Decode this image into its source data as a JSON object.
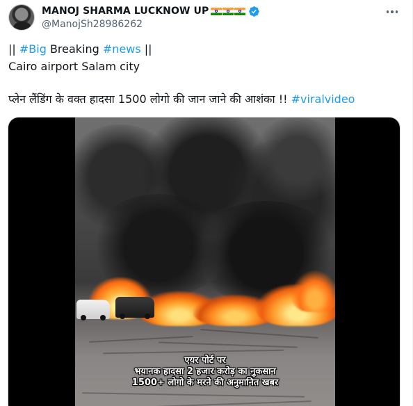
{
  "author": {
    "display_name": "MANOJ SHARMA LUCKNOW UP",
    "handle": "@ManojSh28986262",
    "name_flags": [
      "indian-flag",
      "indian-flag",
      "indian-flag"
    ],
    "verified_badge_color": "#1d9bf0"
  },
  "tweet": {
    "line1": {
      "prefix": "|| ",
      "hashtag1": "#Big",
      "middle": " Breaking ",
      "hashtag2": "#news",
      "suffix": " ||"
    },
    "line2": "Cairo airport Salam city",
    "line3": {
      "text": "प्लेन लैंडिंग के वक्त हादसा 1500 लोगो की जान जाने की आशंका !! ",
      "hashtag": "#viralvideo"
    }
  },
  "media": {
    "caption_lines": [
      "एयर पोर्ट पर",
      "भयानक हादसा 2 हजार करोड़ का नुकसान",
      "1500+ लोगो के मरने की अनुमानित खबर"
    ]
  },
  "colors": {
    "link": "#1d9bf0",
    "text_primary": "#0f1419",
    "text_secondary": "#536471"
  },
  "icons": {
    "more": "more-options-icon",
    "verified": "verified-badge-icon"
  }
}
